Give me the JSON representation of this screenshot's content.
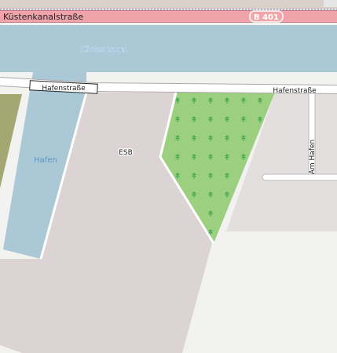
{
  "colors": {
    "background": "#f2f2f0",
    "water": "#aac8d6",
    "water_label": "#5b97c8",
    "industrial": "#dcd4d4",
    "forest": "#9cd080",
    "forest_symbol": "#3aa650",
    "residential": "#e3dfdf",
    "trunk_road": "#f0a3aa",
    "road_casing": "#999999",
    "road_fill": "#ffffff",
    "farmland": "#a3a873"
  },
  "labels": {
    "trunk_road": "Küstenkanalstraße",
    "route_shield": "B 401",
    "canal": "Küstenkanal",
    "harbour": "Hafen",
    "road_west": "Hafenstraße",
    "road_east": "Hafenstraße",
    "industrial_site": "ESB",
    "side_street": "Am Hafen"
  },
  "icons": {
    "forest_symbol": "tree-icon"
  }
}
